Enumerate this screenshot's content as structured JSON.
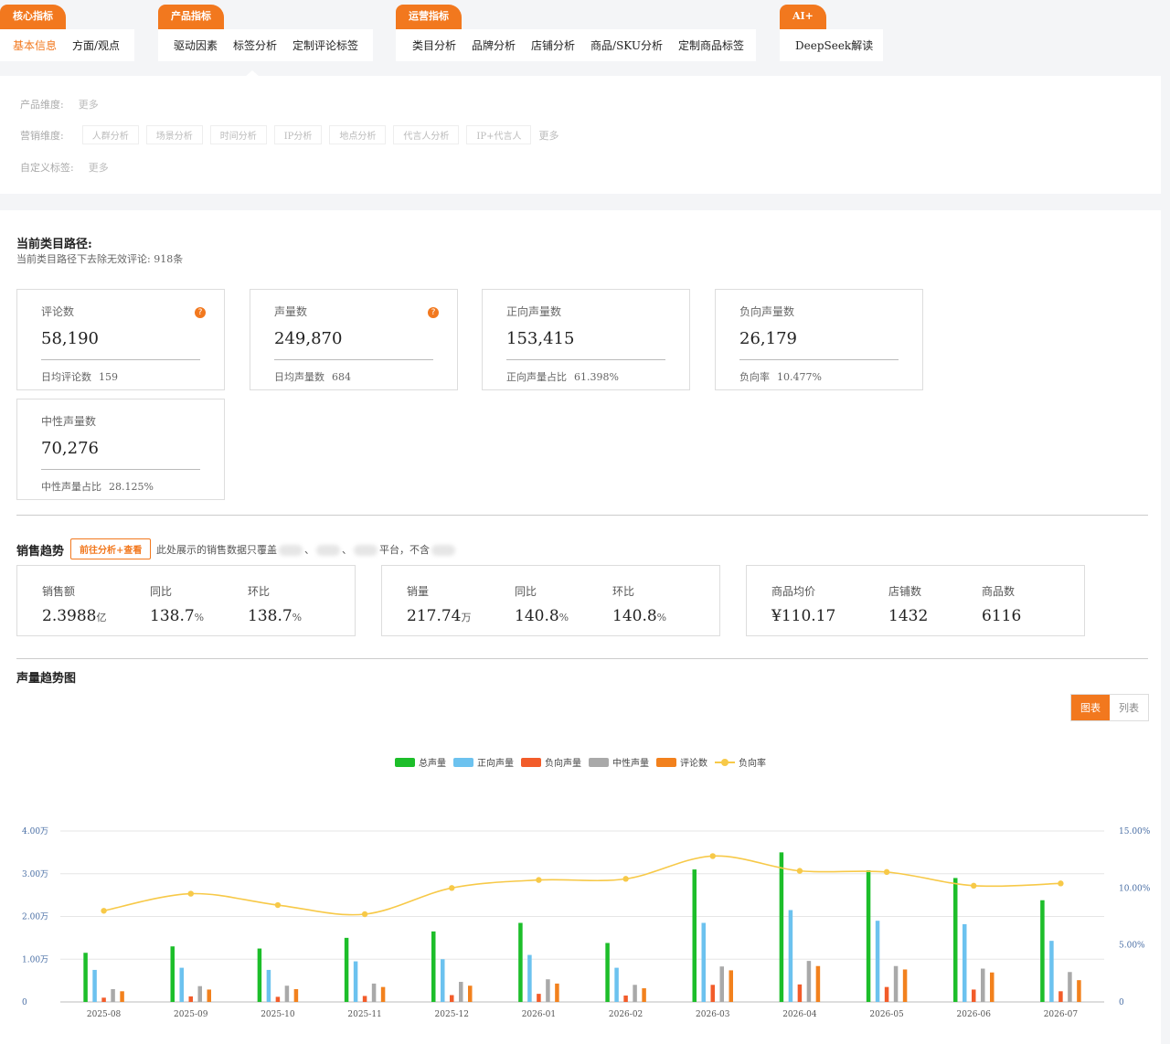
{
  "nav": {
    "groups": [
      {
        "tab": "核心指标",
        "items": [
          "基本信息",
          "方面/观点"
        ]
      },
      {
        "tab": "产品指标",
        "items": [
          "驱动因素",
          "标签分析",
          "定制评论标签"
        ]
      },
      {
        "tab": "运营指标",
        "items": [
          "类目分析",
          "品牌分析",
          "店铺分析",
          "商品/SKU分析",
          "定制商品标签"
        ]
      },
      {
        "tab": "AI+",
        "items": [
          "DeepSeek解读"
        ]
      }
    ]
  },
  "filters": {
    "product_label": "产品维度:",
    "product_more": "更多",
    "marketing_label": "营销维度:",
    "marketing_chips": [
      "人群分析",
      "场景分析",
      "时间分析",
      "IP分析",
      "地点分析",
      "代言人分析",
      "IP+代言人"
    ],
    "marketing_more": "更多",
    "custom_label": "自定义标签:",
    "custom_more": "更多"
  },
  "path": {
    "title": "当前类目路径:",
    "subtitle": "当前类目路径下去除无效评论: 918条"
  },
  "cards": [
    {
      "title": "评论数",
      "value": "58,190",
      "foot_label": "日均评论数",
      "foot_value": "159",
      "help": "?"
    },
    {
      "title": "声量数",
      "value": "249,870",
      "foot_label": "日均声量数",
      "foot_value": "684",
      "help": "?"
    },
    {
      "title": "正向声量数",
      "value": "153,415",
      "foot_label": "正向声量占比",
      "foot_value": "61.398%"
    },
    {
      "title": "负向声量数",
      "value": "26,179",
      "foot_label": "负向率",
      "foot_value": "10.477%"
    },
    {
      "title": "中性声量数",
      "value": "70,276",
      "foot_label": "中性声量占比",
      "foot_value": "28.125%"
    }
  ],
  "sales": {
    "title": "销售趋势",
    "button": "前往分析+查看",
    "note_start": "此处展示的销售数据只覆盖",
    "note_sep": "、",
    "note_platform": "平台，不含",
    "boxes": [
      [
        {
          "label": "销售额",
          "value": "2.3988",
          "unit": "亿"
        },
        {
          "label": "同比",
          "value": "138.7",
          "unit": "%"
        },
        {
          "label": "环比",
          "value": "138.7",
          "unit": "%"
        }
      ],
      [
        {
          "label": "销量",
          "value": "217.74",
          "unit": "万"
        },
        {
          "label": "同比",
          "value": "140.8",
          "unit": "%"
        },
        {
          "label": "环比",
          "value": "140.8",
          "unit": "%"
        }
      ],
      [
        {
          "label": "商品均价",
          "value": "¥110.17",
          "unit": ""
        },
        {
          "label": "店铺数",
          "value": "1432",
          "unit": ""
        },
        {
          "label": "商品数",
          "value": "6116",
          "unit": ""
        }
      ]
    ]
  },
  "volume_chart": {
    "title": "声量趋势图",
    "toggle_chart": "图表",
    "toggle_list": "列表"
  },
  "chart_data": {
    "type": "bar",
    "categories": [
      "2025-08",
      "2025-09",
      "2025-10",
      "2025-11",
      "2025-12",
      "2026-01",
      "2026-02",
      "2026-03",
      "2026-04",
      "2026-05",
      "2026-06",
      "2026-07"
    ],
    "series": [
      {
        "name": "总声量",
        "color": "#1dbe2a",
        "axis": "left",
        "values": [
          11500,
          13000,
          12500,
          15000,
          16500,
          18500,
          13800,
          31000,
          35000,
          30800,
          29000,
          23800
        ]
      },
      {
        "name": "正向声量",
        "color": "#6cc2ef",
        "axis": "left",
        "values": [
          7500,
          8000,
          7500,
          9500,
          10000,
          11000,
          8000,
          18500,
          21500,
          19000,
          18200,
          14300
        ]
      },
      {
        "name": "负向声量",
        "color": "#f25c2a",
        "axis": "left",
        "values": [
          1000,
          1300,
          1200,
          1400,
          1600,
          1900,
          1500,
          4000,
          4100,
          3500,
          2900,
          2500
        ]
      },
      {
        "name": "中性声量",
        "color": "#a9a9a9",
        "axis": "left",
        "values": [
          3000,
          3700,
          3800,
          4300,
          4700,
          5300,
          4000,
          8300,
          9600,
          8400,
          7800,
          7000
        ]
      },
      {
        "name": "评论数",
        "color": "#f2811d",
        "axis": "left",
        "values": [
          2500,
          2900,
          3000,
          3500,
          3800,
          4300,
          3200,
          7400,
          8400,
          7600,
          6900,
          5100
        ]
      },
      {
        "name": "负向率",
        "color": "#f7c948",
        "axis": "right",
        "type": "line",
        "values": [
          8.0,
          9.5,
          8.5,
          7.7,
          10.0,
          10.7,
          10.8,
          12.8,
          11.5,
          11.4,
          10.2,
          10.4
        ]
      }
    ],
    "y_left": {
      "ticks": [
        "0",
        "1.00万",
        "2.00万",
        "3.00万",
        "4.00万"
      ],
      "ylim": [
        0,
        40000
      ]
    },
    "y_right": {
      "ticks": [
        "0",
        "5.00%",
        "10.00%",
        "15.00%"
      ],
      "ylim": [
        0,
        15
      ]
    },
    "legend_position": "top-center",
    "grid": true
  }
}
